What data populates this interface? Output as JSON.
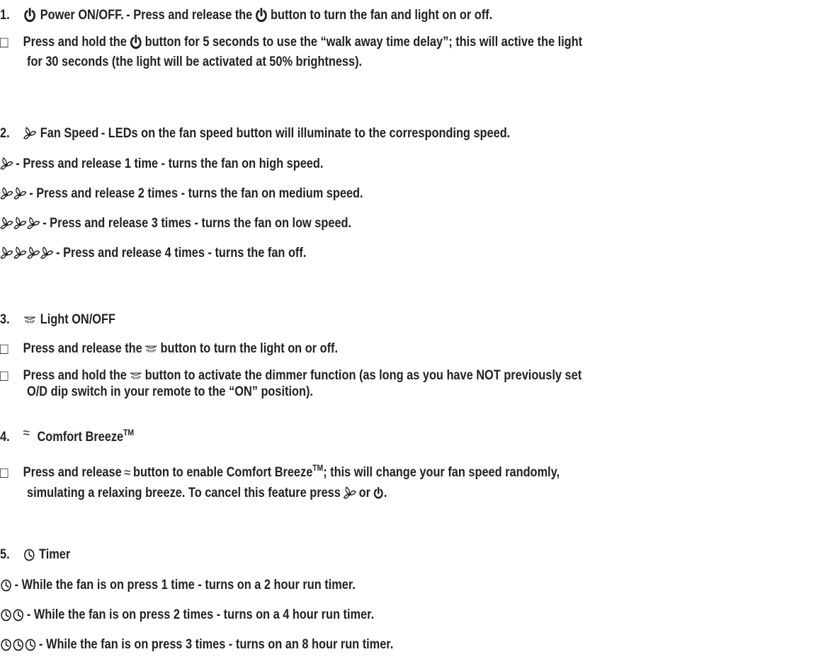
{
  "sections": [
    {
      "number": "1.",
      "icon": "power-icon",
      "title": "Power ON/OFF.",
      "intro": "- Press and release the",
      "intro_tail": "button to turn the fan and light on or off.",
      "bullets": [
        {
          "a": "Press and hold the",
          "b": "button for 5 seconds to use the “walk away time delay”; this will active the light",
          "c": "for 30 seconds (the light will be activated at 50% brightness)."
        }
      ]
    },
    {
      "number": "2.",
      "icon": "fan-icon",
      "title": "Fan Speed",
      "intro": "- LEDs on the fan speed button will illuminate to the corresponding speed.",
      "items": [
        "- Press and release 1 time - turns the fan on high speed.",
        "- Press and release 2 times - turns the fan on medium speed.",
        "- Press and release 3 times - turns the fan on low speed.",
        "- Press and release 4 times - turns the fan off."
      ]
    },
    {
      "number": "3.",
      "icon": "light-icon",
      "title": "Light ON/OFF",
      "bullets": [
        {
          "a": "Press and release the",
          "b": "button to turn the light on or off."
        },
        {
          "a": "Press and hold the",
          "b": "button to activate the dimmer function (as long as you have NOT previously set",
          "c": "O/D dip switch in your remote to the “ON” position)."
        }
      ]
    },
    {
      "number": "4.",
      "icon": "breeze-icon",
      "title": "Comfort Breeze",
      "tm": "TM",
      "bullets": [
        {
          "a": "Press and release",
          "b": "button to enable Comfort Breeze",
          "b_tail": "; this will change your fan speed randomly,",
          "c": "simulating a relaxing breeze. To cancel this feature press",
          "c_mid": "or",
          "c_end": "."
        }
      ]
    },
    {
      "number": "5.",
      "icon": "timer-icon",
      "title": "Timer",
      "items": [
        "- While the fan is on press 1 time - turns on a 2 hour run timer.",
        "- While the fan is on press 2 times - turns on a 4 hour run timer.",
        "- While the fan is on press 3 times - turns on an 8 hour run timer."
      ]
    }
  ],
  "bullet_glyph": "□",
  "breeze_glyph": "≈"
}
